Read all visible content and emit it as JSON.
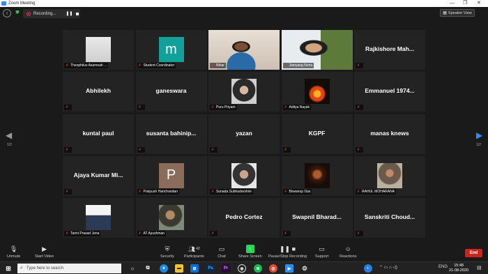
{
  "window": {
    "title": "Zoom Meeting",
    "min": "—",
    "max": "❐",
    "close": "✕"
  },
  "topbar": {
    "recording_label": "Recording...",
    "speaker_view": "Speaker View"
  },
  "nav": {
    "prev": "◀",
    "next": "▶",
    "page_left": "1/2",
    "page_right": "1/2"
  },
  "tiles": [
    {
      "name": "Theophilus Asamoah ...",
      "kind": "photo"
    },
    {
      "name": "Student Coordinator",
      "kind": "letter",
      "letter": "m"
    },
    {
      "name": "Nihar",
      "kind": "video"
    },
    {
      "name": "Jamyang Nortu",
      "kind": "video",
      "active": true
    },
    {
      "name": "Rajkishore  Mah...",
      "kind": "text"
    },
    {
      "name": "Abhilekh",
      "kind": "text"
    },
    {
      "name": "ganeswara",
      "kind": "text"
    },
    {
      "name": "Puru Priyam",
      "kind": "photo"
    },
    {
      "name": "Aditya Nayak",
      "kind": "photo"
    },
    {
      "name": "Emmanuel  1974...",
      "kind": "text"
    },
    {
      "name": "kuntal paul",
      "kind": "text"
    },
    {
      "name": "susanta  bahinip...",
      "kind": "text"
    },
    {
      "name": "yazan",
      "kind": "text"
    },
    {
      "name": "KGPF",
      "kind": "text"
    },
    {
      "name": "manas knews",
      "kind": "text"
    },
    {
      "name": "Ajaya  Kumar  Mi...",
      "kind": "text"
    },
    {
      "name": "Pratyush Harichandan",
      "kind": "letter",
      "letter": "P"
    },
    {
      "name": "Sunada Subhadarshini",
      "kind": "photo"
    },
    {
      "name": "Biswarup Das",
      "kind": "photo"
    },
    {
      "name": "RAHUL MOHARANA",
      "kind": "photo"
    },
    {
      "name": "Tarini Prasad Jena",
      "kind": "photo"
    },
    {
      "name": "AT Ayushman",
      "kind": "photo"
    },
    {
      "name": "Pedro Cortez",
      "kind": "text"
    },
    {
      "name": "Swapnil  Bharad...",
      "kind": "text"
    },
    {
      "name": "Sanskriti  Choud...",
      "kind": "text"
    }
  ],
  "toolbar": {
    "unmute": "Unmute",
    "start_video": "Start Video",
    "security": "Security",
    "participants": "Participants",
    "participants_count": "42",
    "chat": "Chat",
    "share_screen": "Share Screen",
    "recording": "Pause/Stop Recording",
    "support": "Support",
    "reactions": "Reactions",
    "end": "End"
  },
  "taskbar": {
    "search_placeholder": "Type here to search",
    "lang": "ENG",
    "time": "15:48",
    "date": "21-08-2020"
  },
  "colors": {
    "active_speaker": "#c5e03a",
    "end_button": "#d0211c",
    "share_green": "#23d959",
    "zoom_blue": "#2d8cff"
  }
}
